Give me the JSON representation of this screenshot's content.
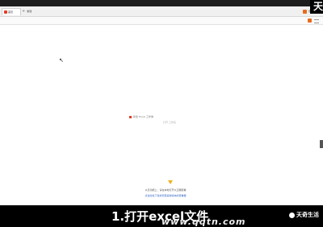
{
  "browser": {
    "tabs": [
      {
        "label": "首页"
      },
      {
        "label": "+"
      },
      {
        "label": "新建"
      }
    ],
    "toolbar_right_label": "登录"
  },
  "center": {
    "line1": "新建 Excel 工作簿",
    "line2": "打开 工作表"
  },
  "notice": {
    "line1": "以及功能上，请在本地打开以正确查看",
    "line2": "点击此处下载并安装最新版本的查看器"
  },
  "watermark": {
    "top_char": "天",
    "brand": "天奇生活",
    "url": "www.qqtn.com"
  },
  "caption": {
    "title": "1.打开excel文件"
  }
}
